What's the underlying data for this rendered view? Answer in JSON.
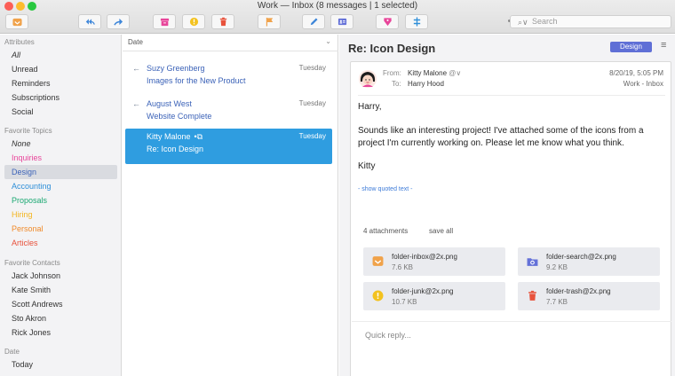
{
  "window": {
    "title": "Work — Inbox (8 messages | 1 selected)"
  },
  "toolbar": {
    "colors": {
      "orange": "#f0a24a",
      "blue": "#3e86d9",
      "pink": "#e8459a",
      "yellow": "#f3c21f",
      "red": "#e8523c",
      "purple": "#6471d8"
    },
    "buttons": [
      {
        "icon": "inbox-icon"
      },
      {
        "icon": "reply-all-icon"
      },
      {
        "icon": "forward-icon"
      },
      {
        "icon": "archive-icon"
      },
      {
        "icon": "junk-icon"
      },
      {
        "icon": "trash-icon"
      },
      {
        "icon": "flag-icon"
      },
      {
        "icon": "compose-icon"
      },
      {
        "icon": "contact-card-icon"
      },
      {
        "icon": "tag-icon"
      },
      {
        "icon": "filter-icon"
      }
    ],
    "search_placeholder": "Search"
  },
  "sidebar": {
    "sections": [
      {
        "title": "Attributes",
        "items": [
          "All",
          "Unread",
          "Reminders",
          "Subscriptions",
          "Social"
        ]
      },
      {
        "title": "Favorite Topics",
        "items": [
          "None",
          "Inquiries",
          "Design",
          "Accounting",
          "Proposals",
          "Hiring",
          "Personal",
          "Articles"
        ]
      },
      {
        "title": "Favorite Contacts",
        "items": [
          "Jack Johnson",
          "Kate Smith",
          "Scott Andrews",
          "Sto Akron",
          "Rick Jones"
        ]
      },
      {
        "title": "Date",
        "items": [
          "Today"
        ]
      }
    ],
    "topic_colors": {
      "Inquiries": "#e8459a",
      "Design": "#3c63b8",
      "Accounting": "#2f8fd8",
      "Proposals": "#1aa872",
      "Hiring": "#f3b51f",
      "Personal": "#f08a2a",
      "Articles": "#e8523c"
    },
    "selected": "Design"
  },
  "message_list": {
    "sort_label": "Date",
    "messages": [
      {
        "sender": "Suzy Greenberg",
        "subject": "Images for the New Product",
        "date": "Tuesday",
        "replied": true,
        "attachment": false,
        "selected": false
      },
      {
        "sender": "August West",
        "subject": "Website Complete",
        "date": "Tuesday",
        "replied": true,
        "attachment": false,
        "selected": false
      },
      {
        "sender": "Kitty Malone",
        "subject": "Re: Icon Design",
        "date": "Tuesday",
        "replied": false,
        "attachment": true,
        "selected": true
      }
    ]
  },
  "reader": {
    "subject": "Re: Icon Design",
    "tag": "Design",
    "from_label": "From:",
    "to_label": "To:",
    "from": "Kitty Malone",
    "to": "Harry Hood",
    "date": "8/20/19, 5:05 PM",
    "folder": "Work - Inbox",
    "body": {
      "greeting": "Harry,",
      "paragraph": "Sounds like an interesting project! I've attached some of the icons from a project I'm currently working on. Please let me know what you think.",
      "signoff": "Kitty"
    },
    "show_quoted": "- show quoted text -",
    "attachments_count": "4 attachments",
    "save_all": "save all",
    "attachments": [
      {
        "name": "folder-inbox@2x.png",
        "size": "7.6 KB",
        "icon": "inbox-icon"
      },
      {
        "name": "folder-search@2x.png",
        "size": "9.2 KB",
        "icon": "folder-search-icon"
      },
      {
        "name": "folder-junk@2x.png",
        "size": "10.7 KB",
        "icon": "junk-icon"
      },
      {
        "name": "folder-trash@2x.png",
        "size": "7.7 KB",
        "icon": "trash-icon"
      }
    ],
    "quick_reply": "Quick reply..."
  }
}
